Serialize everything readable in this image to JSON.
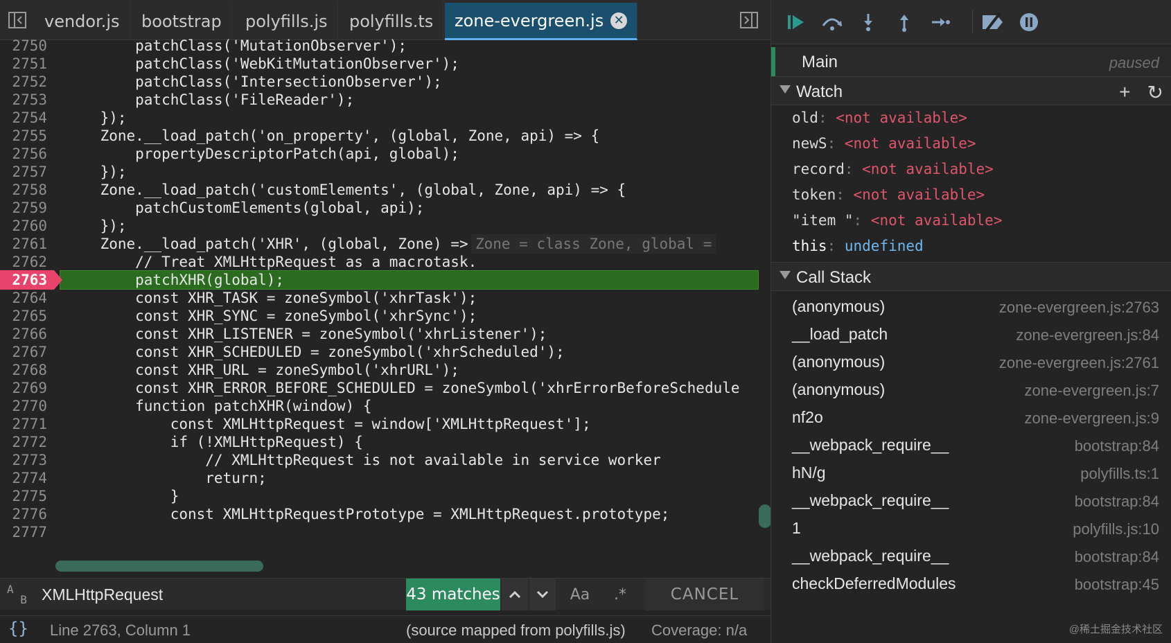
{
  "editor": {
    "tabs": [
      {
        "label": "vendor.js",
        "active": false
      },
      {
        "label": "bootstrap",
        "active": false
      },
      {
        "label": "polyfills.js",
        "active": false
      },
      {
        "label": "polyfills.ts",
        "active": false
      },
      {
        "label": "zone-evergreen.js",
        "active": true
      }
    ],
    "current_line": "2763",
    "lines": [
      {
        "n": "2750",
        "src": "        patchClass('MutationObserver');"
      },
      {
        "n": "2751",
        "src": "        patchClass('WebKitMutationObserver');"
      },
      {
        "n": "2752",
        "src": "        patchClass('IntersectionObserver');"
      },
      {
        "n": "2753",
        "src": "        patchClass('FileReader');"
      },
      {
        "n": "2754",
        "src": "    });"
      },
      {
        "n": "2755",
        "src": "    Zone.__load_patch('on_property', (global, Zone, api) => {"
      },
      {
        "n": "2756",
        "src": "        propertyDescriptorPatch(api, global);"
      },
      {
        "n": "2757",
        "src": "    });"
      },
      {
        "n": "2758",
        "src": "    Zone.__load_patch('customElements', (global, Zone, api) => {"
      },
      {
        "n": "2759",
        "src": "        patchCustomElements(global, api);"
      },
      {
        "n": "2760",
        "src": "    });"
      },
      {
        "n": "2761",
        "src": "    Zone.__load_patch('XHR', (global, Zone) => {",
        "inline": "Zone = class Zone, global ="
      },
      {
        "n": "2762",
        "src": "        // Treat XMLHttpRequest as a macrotask."
      },
      {
        "n": "2763",
        "src": "        patchXHR(global);"
      },
      {
        "n": "2764",
        "src": "        const XHR_TASK = zoneSymbol('xhrTask');"
      },
      {
        "n": "2765",
        "src": "        const XHR_SYNC = zoneSymbol('xhrSync');"
      },
      {
        "n": "2766",
        "src": "        const XHR_LISTENER = zoneSymbol('xhrListener');"
      },
      {
        "n": "2767",
        "src": "        const XHR_SCHEDULED = zoneSymbol('xhrScheduled');"
      },
      {
        "n": "2768",
        "src": "        const XHR_URL = zoneSymbol('xhrURL');"
      },
      {
        "n": "2769",
        "src": "        const XHR_ERROR_BEFORE_SCHEDULED = zoneSymbol('xhrErrorBeforeSchedule"
      },
      {
        "n": "2770",
        "src": "        function patchXHR(window) {"
      },
      {
        "n": "2771",
        "src": "            const XMLHttpRequest = window['XMLHttpRequest'];"
      },
      {
        "n": "2772",
        "src": "            if (!XMLHttpRequest) {"
      },
      {
        "n": "2773",
        "src": "                // XMLHttpRequest is not available in service worker"
      },
      {
        "n": "2774",
        "src": "                return;"
      },
      {
        "n": "2775",
        "src": "            }"
      },
      {
        "n": "2776",
        "src": "            const XMLHttpRequestPrototype = XMLHttpRequest.prototype;"
      },
      {
        "n": "2777",
        "src": ""
      }
    ]
  },
  "search": {
    "value": "XMLHttpRequest",
    "matches": "43 matches",
    "case_label": "Aa",
    "regex_label": ".*",
    "cancel_label": "CANCEL"
  },
  "status": {
    "position": "Line 2763, Column 1",
    "source_map": "(source mapped from polyfills.js)",
    "coverage": "Coverage: n/a"
  },
  "debugger": {
    "thread": {
      "name": "Main",
      "status": "paused"
    },
    "watch": {
      "title": "Watch",
      "items": [
        {
          "key": "old",
          "value": "<not available>",
          "kind": "na"
        },
        {
          "key": "newS",
          "value": "<not available>",
          "kind": "na"
        },
        {
          "key": "record",
          "value": "<not available>",
          "kind": "na"
        },
        {
          "key": "token",
          "value": "<not available>",
          "kind": "na"
        },
        {
          "key": "\"item \"",
          "value": "<not available>",
          "kind": "na"
        },
        {
          "key": "this",
          "value": "undefined",
          "kind": "undef"
        }
      ]
    },
    "callstack": {
      "title": "Call Stack",
      "frames": [
        {
          "name": "(anonymous)",
          "loc": "zone-evergreen.js:2763"
        },
        {
          "name": "__load_patch",
          "loc": "zone-evergreen.js:84"
        },
        {
          "name": "(anonymous)",
          "loc": "zone-evergreen.js:2761"
        },
        {
          "name": "(anonymous)",
          "loc": "zone-evergreen.js:7"
        },
        {
          "name": "nf2o",
          "loc": "zone-evergreen.js:9"
        },
        {
          "name": "__webpack_require__",
          "loc": "bootstrap:84"
        },
        {
          "name": "hN/g",
          "loc": "polyfills.ts:1"
        },
        {
          "name": "__webpack_require__",
          "loc": "bootstrap:84"
        },
        {
          "name": "1",
          "loc": "polyfills.js:10"
        },
        {
          "name": "__webpack_require__",
          "loc": "bootstrap:84"
        },
        {
          "name": "checkDeferredModules",
          "loc": "bootstrap:45"
        }
      ]
    }
  },
  "watermark": "@稀土掘金技术社区"
}
